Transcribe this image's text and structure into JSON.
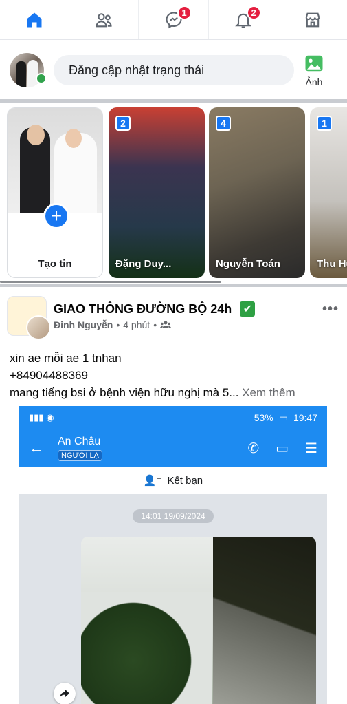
{
  "nav": {
    "messages_badge": "1",
    "notifications_badge": "2"
  },
  "composer": {
    "placeholder": "Đăng cập nhật trạng thái",
    "photo_label": "Ảnh"
  },
  "stories": {
    "create_label": "Tạo tin",
    "items": [
      {
        "count": "2",
        "name": "Đặng Duy..."
      },
      {
        "count": "4",
        "name": "Nguyễn Toán"
      },
      {
        "count": "1",
        "name": "Thu Hương"
      }
    ]
  },
  "post": {
    "group_name": "GIAO THÔNG ĐƯỜNG BỘ 24h",
    "verified_emoji": "✔",
    "author": "Đinh Nguyễn",
    "time": "4 phút",
    "text_line1": "xin ae mỗi ae 1 tnhan",
    "text_line2": "+84904488369",
    "text_line3": "mang tiếng bsi ở bệnh viện hữu nghị mà 5...",
    "see_more": "Xem thêm",
    "image": {
      "battery": "53%",
      "clock": "19:47",
      "contact_name": "An Châu",
      "contact_tag": "NGƯỜI LẠ",
      "add_friend": "Kết bạn",
      "timestamp": "14:01 19/09/2024"
    }
  },
  "colors": {
    "accent": "#1877f2",
    "badge": "#e41e3f",
    "online": "#31a24c",
    "zalo_blue": "#1d8bf1"
  }
}
